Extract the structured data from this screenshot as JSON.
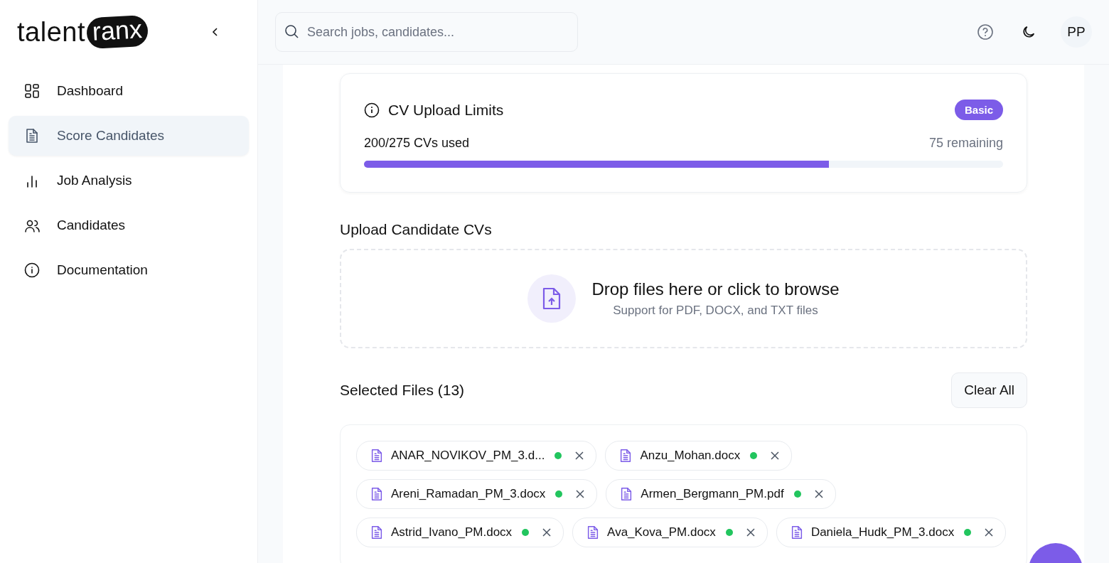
{
  "sidebar": {
    "logo": {
      "word": "talent",
      "badge": "ranx"
    },
    "items": [
      {
        "label": "Dashboard",
        "kind": "grid",
        "selected": false
      },
      {
        "label": "Score Candidates",
        "kind": "document",
        "selected": true
      },
      {
        "label": "Job Analysis",
        "kind": "chart",
        "selected": false
      },
      {
        "label": "Candidates",
        "kind": "users",
        "selected": false
      },
      {
        "label": "Documentation",
        "kind": "info",
        "selected": false
      }
    ]
  },
  "header": {
    "search": {
      "placeholder": "Search jobs, candidates..."
    },
    "avatar": "PP"
  },
  "limits": {
    "title": "CV Upload Limits",
    "plan": "Basic",
    "used": "200/275 CVs used",
    "remaining": "75 remaining",
    "level": 0.727
  },
  "upload": {
    "title": "Upload Candidate CVs",
    "prompt": "Drop files here or click to browse",
    "hint": "Support for PDF, DOCX, and TXT files"
  },
  "selected_files": {
    "title": "Selected Files (13)",
    "clear_button": "Clear All",
    "files": [
      {
        "name": "ANAR_NOVIKOV_PM_3.d...",
        "color": "#22c55e"
      },
      {
        "name": "Anzu_Mohan.docx",
        "color": "#22c55e"
      },
      {
        "name": "Areni_Ramadan_PM_3.docx",
        "color": "#22c55e"
      },
      {
        "name": "Armen_Bergmann_PM.pdf",
        "color": "#22c55e"
      },
      {
        "name": "Astrid_Ivano_PM.docx",
        "color": "#22c55e"
      },
      {
        "name": "Ava_Kova_PM.docx",
        "color": "#22c55e"
      },
      {
        "name": "Daniela_Hudk_PM_3.docx",
        "color": "#22c55e"
      }
    ]
  }
}
